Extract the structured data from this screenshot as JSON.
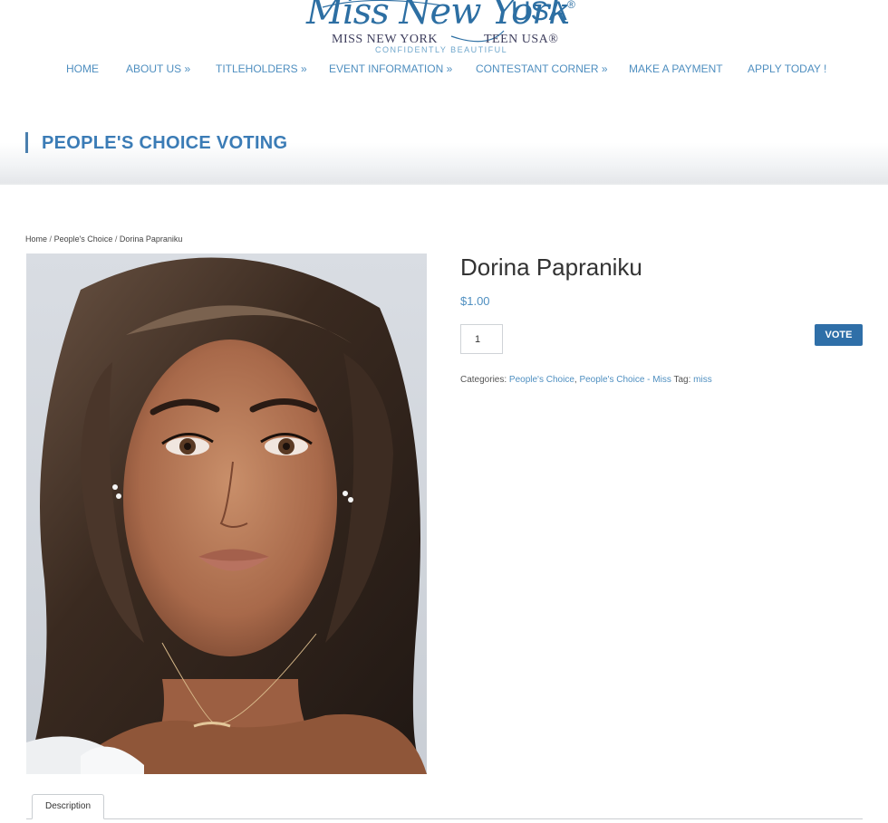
{
  "logo": {
    "script": "Miss New York",
    "usa": "USA",
    "registered": "®",
    "sub_left": "MISS NEW YORK",
    "sub_right": "TEEN USA®",
    "tagline": "CONFIDENTLY BEAUTIFUL"
  },
  "nav": {
    "items": [
      {
        "label": "HOME"
      },
      {
        "label": "ABOUT US »"
      },
      {
        "label": "TITLEHOLDERS »"
      },
      {
        "label": "EVENT INFORMATION »"
      },
      {
        "label": "CONTESTANT CORNER »"
      },
      {
        "label": "MAKE A PAYMENT"
      },
      {
        "label": "APPLY TODAY !"
      }
    ]
  },
  "page": {
    "title": "PEOPLE'S CHOICE VOTING"
  },
  "breadcrumb": {
    "home": "Home",
    "category": "People's Choice",
    "current": "Dorina Papraniku",
    "separator": "/"
  },
  "product": {
    "name": "Dorina Papraniku",
    "price": "$1.00",
    "quantity": "1",
    "vote_label": "VOTE",
    "categories_label": "Categories:",
    "categories": [
      "People's Choice",
      "People's Choice - Miss"
    ],
    "tag_label": "Tag:",
    "tag": "miss"
  },
  "tabs": {
    "description": "Description"
  },
  "colors": {
    "accent": "#4f8fc0",
    "title": "#3b7cb6",
    "button": "#2f6fa8"
  }
}
